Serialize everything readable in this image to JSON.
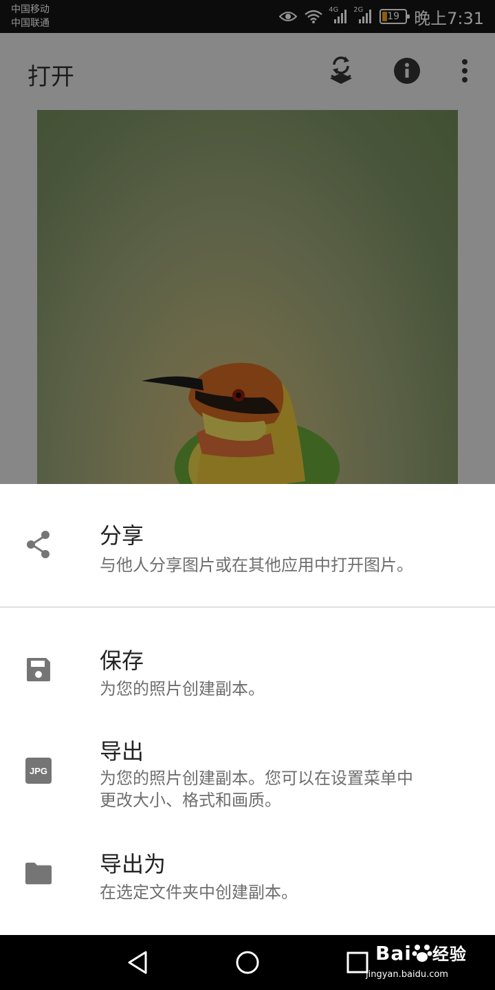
{
  "status_bar": {
    "carrier_1": "中国移动",
    "carrier_2": "中国联通",
    "net_1": "4G",
    "net_2": "2G",
    "battery_level": "19",
    "time": "晚上7:31"
  },
  "app": {
    "title": "打开",
    "toolbar_icons": [
      "layers-refresh-icon",
      "info-icon",
      "more-vert-icon"
    ]
  },
  "sheet": {
    "options": [
      {
        "icon": "share-icon",
        "title": "分享",
        "desc": "与他人分享图片或在其他应用中打开图片。"
      },
      {
        "icon": "save-icon",
        "title": "保存",
        "desc": "为您的照片创建副本。"
      },
      {
        "icon": "jpg-icon",
        "icon_text": "JPG",
        "title": "导出",
        "desc_line1": "为您的照片创建副本。您可以在设置菜单中",
        "desc_line2": "更改大小、格式和画质。"
      },
      {
        "icon": "folder-icon",
        "title": "导出为",
        "desc": "在选定文件夹中创建副本。"
      }
    ]
  },
  "watermark": {
    "logo_text": "Bai",
    "logo_text_2": "经验",
    "url": "jingyan.baidu.com"
  },
  "colors": {
    "sheet_background": "#ffffff",
    "icon_gray": "#757575",
    "battery_accent": "#f0a020"
  }
}
